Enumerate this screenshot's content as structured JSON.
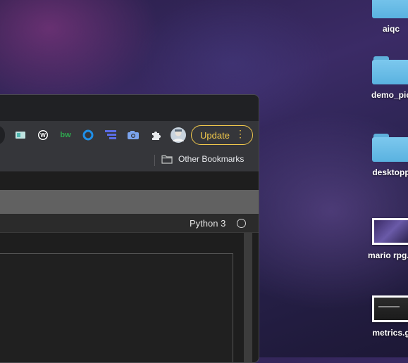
{
  "desktop": {
    "items": [
      {
        "label": "aiqc",
        "kind": "folder"
      },
      {
        "label": "demo_pic",
        "kind": "folder"
      },
      {
        "label": "desktopp",
        "kind": "folder"
      },
      {
        "label": "mario rpg.p",
        "kind": "image"
      },
      {
        "label": "metrics.g",
        "kind": "image"
      }
    ]
  },
  "browser": {
    "extensions": [
      "reader-icon",
      "w-icon",
      "bw-icon",
      "circle-icon",
      "stack-icon",
      "camera-icon",
      "puzzle-icon",
      "avatar"
    ],
    "ext_bw_text": "bw",
    "ext_w_text": "W",
    "update_label": "Update",
    "other_bookmarks": "Other Bookmarks"
  },
  "notebook": {
    "kernel_name": "Python 3"
  },
  "colors": {
    "update_accent": "#f2c94c",
    "folder_blue": "#6cbde8"
  }
}
